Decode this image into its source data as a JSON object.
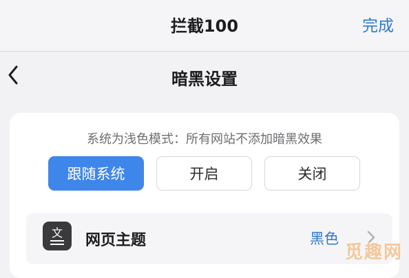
{
  "header": {
    "title": "拦截100",
    "done_label": "完成"
  },
  "nav": {
    "title": "暗黑设置",
    "back_icon": "chevron-left-icon"
  },
  "dark_mode": {
    "status_text": "系统为浅色模式：所有网站不添加暗黑效果",
    "options": [
      {
        "label": "跟随系统",
        "selected": true
      },
      {
        "label": "开启",
        "selected": false
      },
      {
        "label": "关闭",
        "selected": false
      }
    ]
  },
  "theme_row": {
    "icon": "document-text-icon",
    "label": "网页主题",
    "value": "黑色"
  },
  "watermark": {
    "text": "觅趣网"
  },
  "colors": {
    "accent": "#3f86eb",
    "link": "#2f78d6",
    "background": "#f2f2f4",
    "card": "#ffffff"
  }
}
